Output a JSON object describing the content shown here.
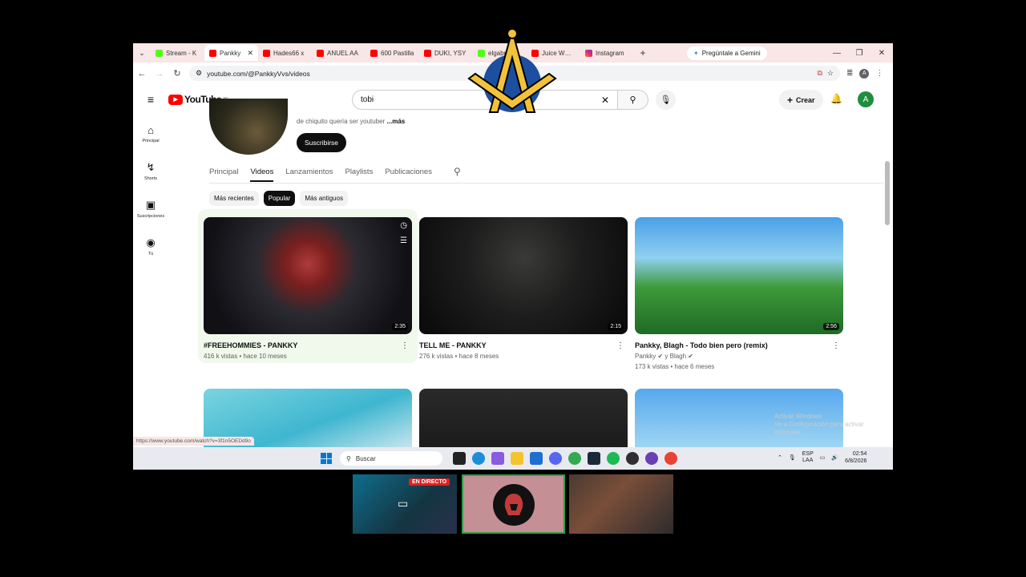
{
  "browser": {
    "tabs": [
      {
        "label": "Stream - K",
        "icon": "kick",
        "active": false
      },
      {
        "label": "Pankky",
        "icon": "youtube",
        "active": true
      },
      {
        "label": "Hades66 x",
        "icon": "youtube",
        "active": false
      },
      {
        "label": "ANUEL AA",
        "icon": "youtube",
        "active": false
      },
      {
        "label": "600 Pastilla",
        "icon": "youtube",
        "active": false
      },
      {
        "label": "DUKI, YSY",
        "icon": "youtube",
        "active": false
      },
      {
        "label": "elgabris St",
        "icon": "kick",
        "active": false
      },
      {
        "label": "Juice WRLD",
        "icon": "youtube",
        "active": false
      },
      {
        "label": "Instagram",
        "icon": "instagram",
        "active": false
      }
    ],
    "gemini_label": "Pregúntale a Gemini",
    "url": "youtube.com/@PankkyVvs/videos",
    "status_url": "https://www.youtube.com/watch?v=3f1n5OEDd9o"
  },
  "youtube": {
    "logo_text": "YouTube",
    "logo_country": "AR",
    "search_value": "tobi",
    "create_label": "Crear",
    "avatar_letter": "A",
    "guide": [
      {
        "label": "Principal",
        "icon": "home-icon",
        "glyph": "⌂"
      },
      {
        "label": "Shorts",
        "icon": "shorts-icon",
        "glyph": "↯"
      },
      {
        "label": "Suscripciones",
        "icon": "subscriptions-icon",
        "glyph": "▣"
      },
      {
        "label": "Tú",
        "icon": "you-icon",
        "glyph": "◉"
      }
    ],
    "channel": {
      "description": "de chiquito quería ser youtuber",
      "more": "...más",
      "subscribe": "Suscribirse"
    },
    "tabs": [
      "Principal",
      "Videos",
      "Lanzamientos",
      "Playlists",
      "Publicaciones"
    ],
    "active_tab": "Videos",
    "chips": [
      "Más recientes",
      "Popular",
      "Más antiguos"
    ],
    "active_chip": "Popular",
    "videos": [
      {
        "title": "#FREEHOMMIES - PANKKY",
        "meta": "416 k vistas • hace 10 meses",
        "duration": "2:35",
        "channel_line": ""
      },
      {
        "title": "TELL ME - PANKKY",
        "meta": "276 k vistas • hace 8 meses",
        "duration": "2:15",
        "channel_line": ""
      },
      {
        "title": "Pankky, Blagh - Todo bien pero (remix)",
        "meta": "173 k vistas • hace 6 meses",
        "duration": "2:56",
        "channel_line": "Pankky ✔ y Blagh ✔"
      }
    ],
    "watermark": [
      "Activar Windows",
      "Ve a Configuración para activar Windows."
    ]
  },
  "taskbar": {
    "search_placeholder": "Buscar",
    "lang_top": "ESP",
    "lang_bottom": "LAA",
    "time": "02:54",
    "date": "6/8/2026"
  },
  "stream": {
    "live_label": "EN DIRECTO"
  },
  "colors": {
    "youtube_red": "#ff0000",
    "tab_strip": "#f9e6e6",
    "hover_card": "#f0f9ec"
  }
}
